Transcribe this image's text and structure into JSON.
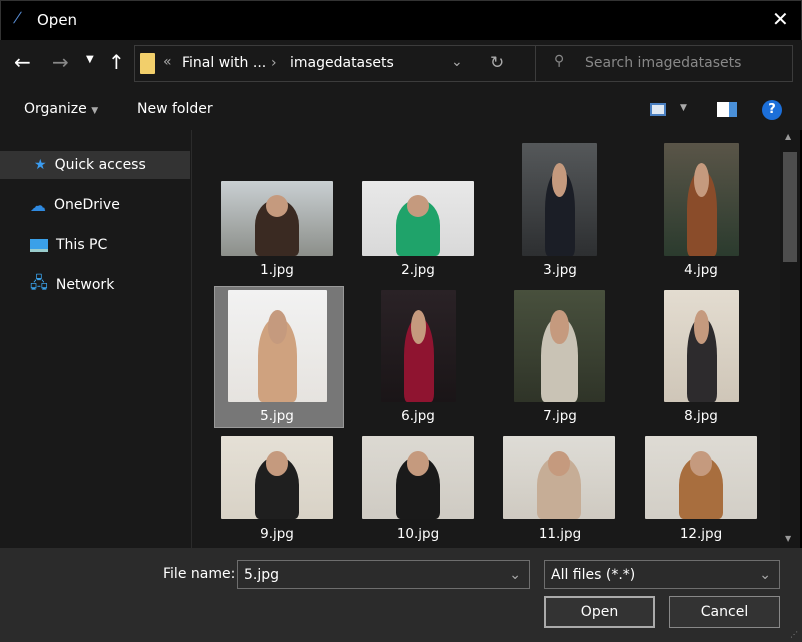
{
  "window": {
    "title": "Open",
    "close_icon": "close-icon"
  },
  "nav": {
    "breadcrumb_prefix": "«",
    "breadcrumb": [
      "Final with ...",
      "imagedatasets"
    ],
    "search_placeholder": "Search imagedatasets"
  },
  "toolbar": {
    "organize": "Organize",
    "new_folder": "New folder"
  },
  "sidebar": {
    "items": [
      {
        "label": "Quick access",
        "icon": "star-icon",
        "selected": true
      },
      {
        "label": "OneDrive",
        "icon": "cloud-icon"
      },
      {
        "label": "This PC",
        "icon": "monitor-icon"
      },
      {
        "label": "Network",
        "icon": "network-icon"
      }
    ]
  },
  "files": [
    {
      "name": "1.jpg"
    },
    {
      "name": "2.jpg"
    },
    {
      "name": "3.jpg"
    },
    {
      "name": "4.jpg"
    },
    {
      "name": "5.jpg",
      "selected": true
    },
    {
      "name": "6.jpg"
    },
    {
      "name": "7.jpg"
    },
    {
      "name": "8.jpg"
    },
    {
      "name": "9.jpg"
    },
    {
      "name": "10.jpg"
    },
    {
      "name": "11.jpg"
    },
    {
      "name": "12.jpg"
    }
  ],
  "bottom": {
    "file_name_label": "File name:",
    "file_name_value": "5.jpg",
    "file_type": "All files (*.*)",
    "open": "Open",
    "cancel": "Cancel"
  }
}
